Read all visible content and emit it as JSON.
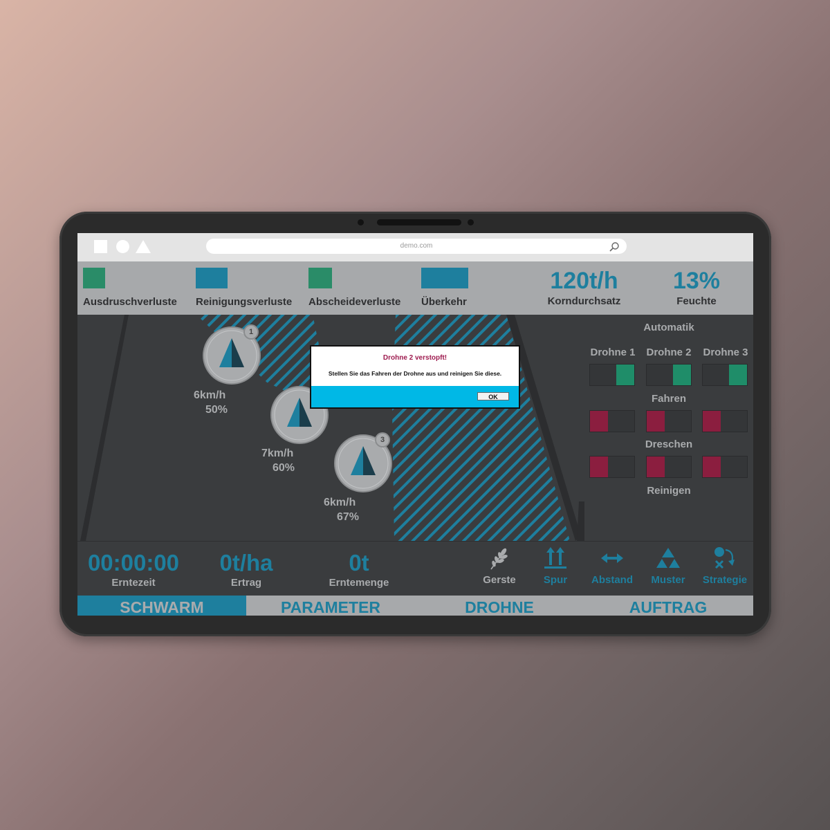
{
  "browser": {
    "url": "demo.com"
  },
  "header": {
    "indicators": [
      {
        "label": "Ausdruschverluste",
        "color": "#2a8c68"
      },
      {
        "label": "Reinigungsverluste",
        "color": "#1e7f9e"
      },
      {
        "label": "Abscheideverluste",
        "color": "#2a8c68"
      },
      {
        "label": "Überkehr",
        "color": "#1e7f9e"
      }
    ],
    "metrics": [
      {
        "value": "120t/h",
        "label": "Korndurchsatz"
      },
      {
        "value": "13%",
        "label": "Feuchte"
      }
    ]
  },
  "map": {
    "drones": [
      {
        "number": "1",
        "speed": "6km/h",
        "percent": "50%"
      },
      {
        "number": "",
        "speed": "7km/h",
        "percent": "60%"
      },
      {
        "number": "3",
        "speed": "6km/h",
        "percent": "67%"
      }
    ]
  },
  "panel": {
    "title": "Automatik",
    "columns": [
      "Drohne 1",
      "Drohne 2",
      "Drohne 3"
    ],
    "rows": [
      {
        "label": "Fahren",
        "states": [
          "on",
          "on",
          "on"
        ]
      },
      {
        "label": "Dreschen",
        "states": [
          "off",
          "off",
          "off"
        ]
      },
      {
        "label": "Reinigen",
        "states": [
          "off",
          "off",
          "off"
        ]
      }
    ]
  },
  "stats": [
    {
      "value": "00:00:00",
      "label": "Erntezeit"
    },
    {
      "value": "0t/ha",
      "label": "Ertrag"
    },
    {
      "value": "0t",
      "label": "Erntemenge"
    }
  ],
  "tools": [
    {
      "label": "Gerste",
      "icon": "wheat-icon"
    },
    {
      "label": "Spur",
      "icon": "track-arrows-icon"
    },
    {
      "label": "Abstand",
      "icon": "distance-arrows-icon"
    },
    {
      "label": "Muster",
      "icon": "pattern-triangles-icon"
    },
    {
      "label": "Strategie",
      "icon": "strategy-icon"
    }
  ],
  "tabs": [
    {
      "label": "SCHWARM",
      "active": true
    },
    {
      "label": "PARAMETER",
      "active": false
    },
    {
      "label": "DROHNE",
      "active": false
    },
    {
      "label": "AUFTRAG",
      "active": false
    }
  ],
  "dialog": {
    "title": "Drohne 2 verstopft!",
    "message": "Stellen Sie das Fahren der Drohne aus und reinigen Sie diese.",
    "ok_label": "OK"
  },
  "colors": {
    "accent": "#1e7f9e",
    "on": "#1f8d69",
    "off": "#8b1e3f",
    "alert": "#9e1b4f",
    "dialog_bar": "#00b8e6"
  }
}
